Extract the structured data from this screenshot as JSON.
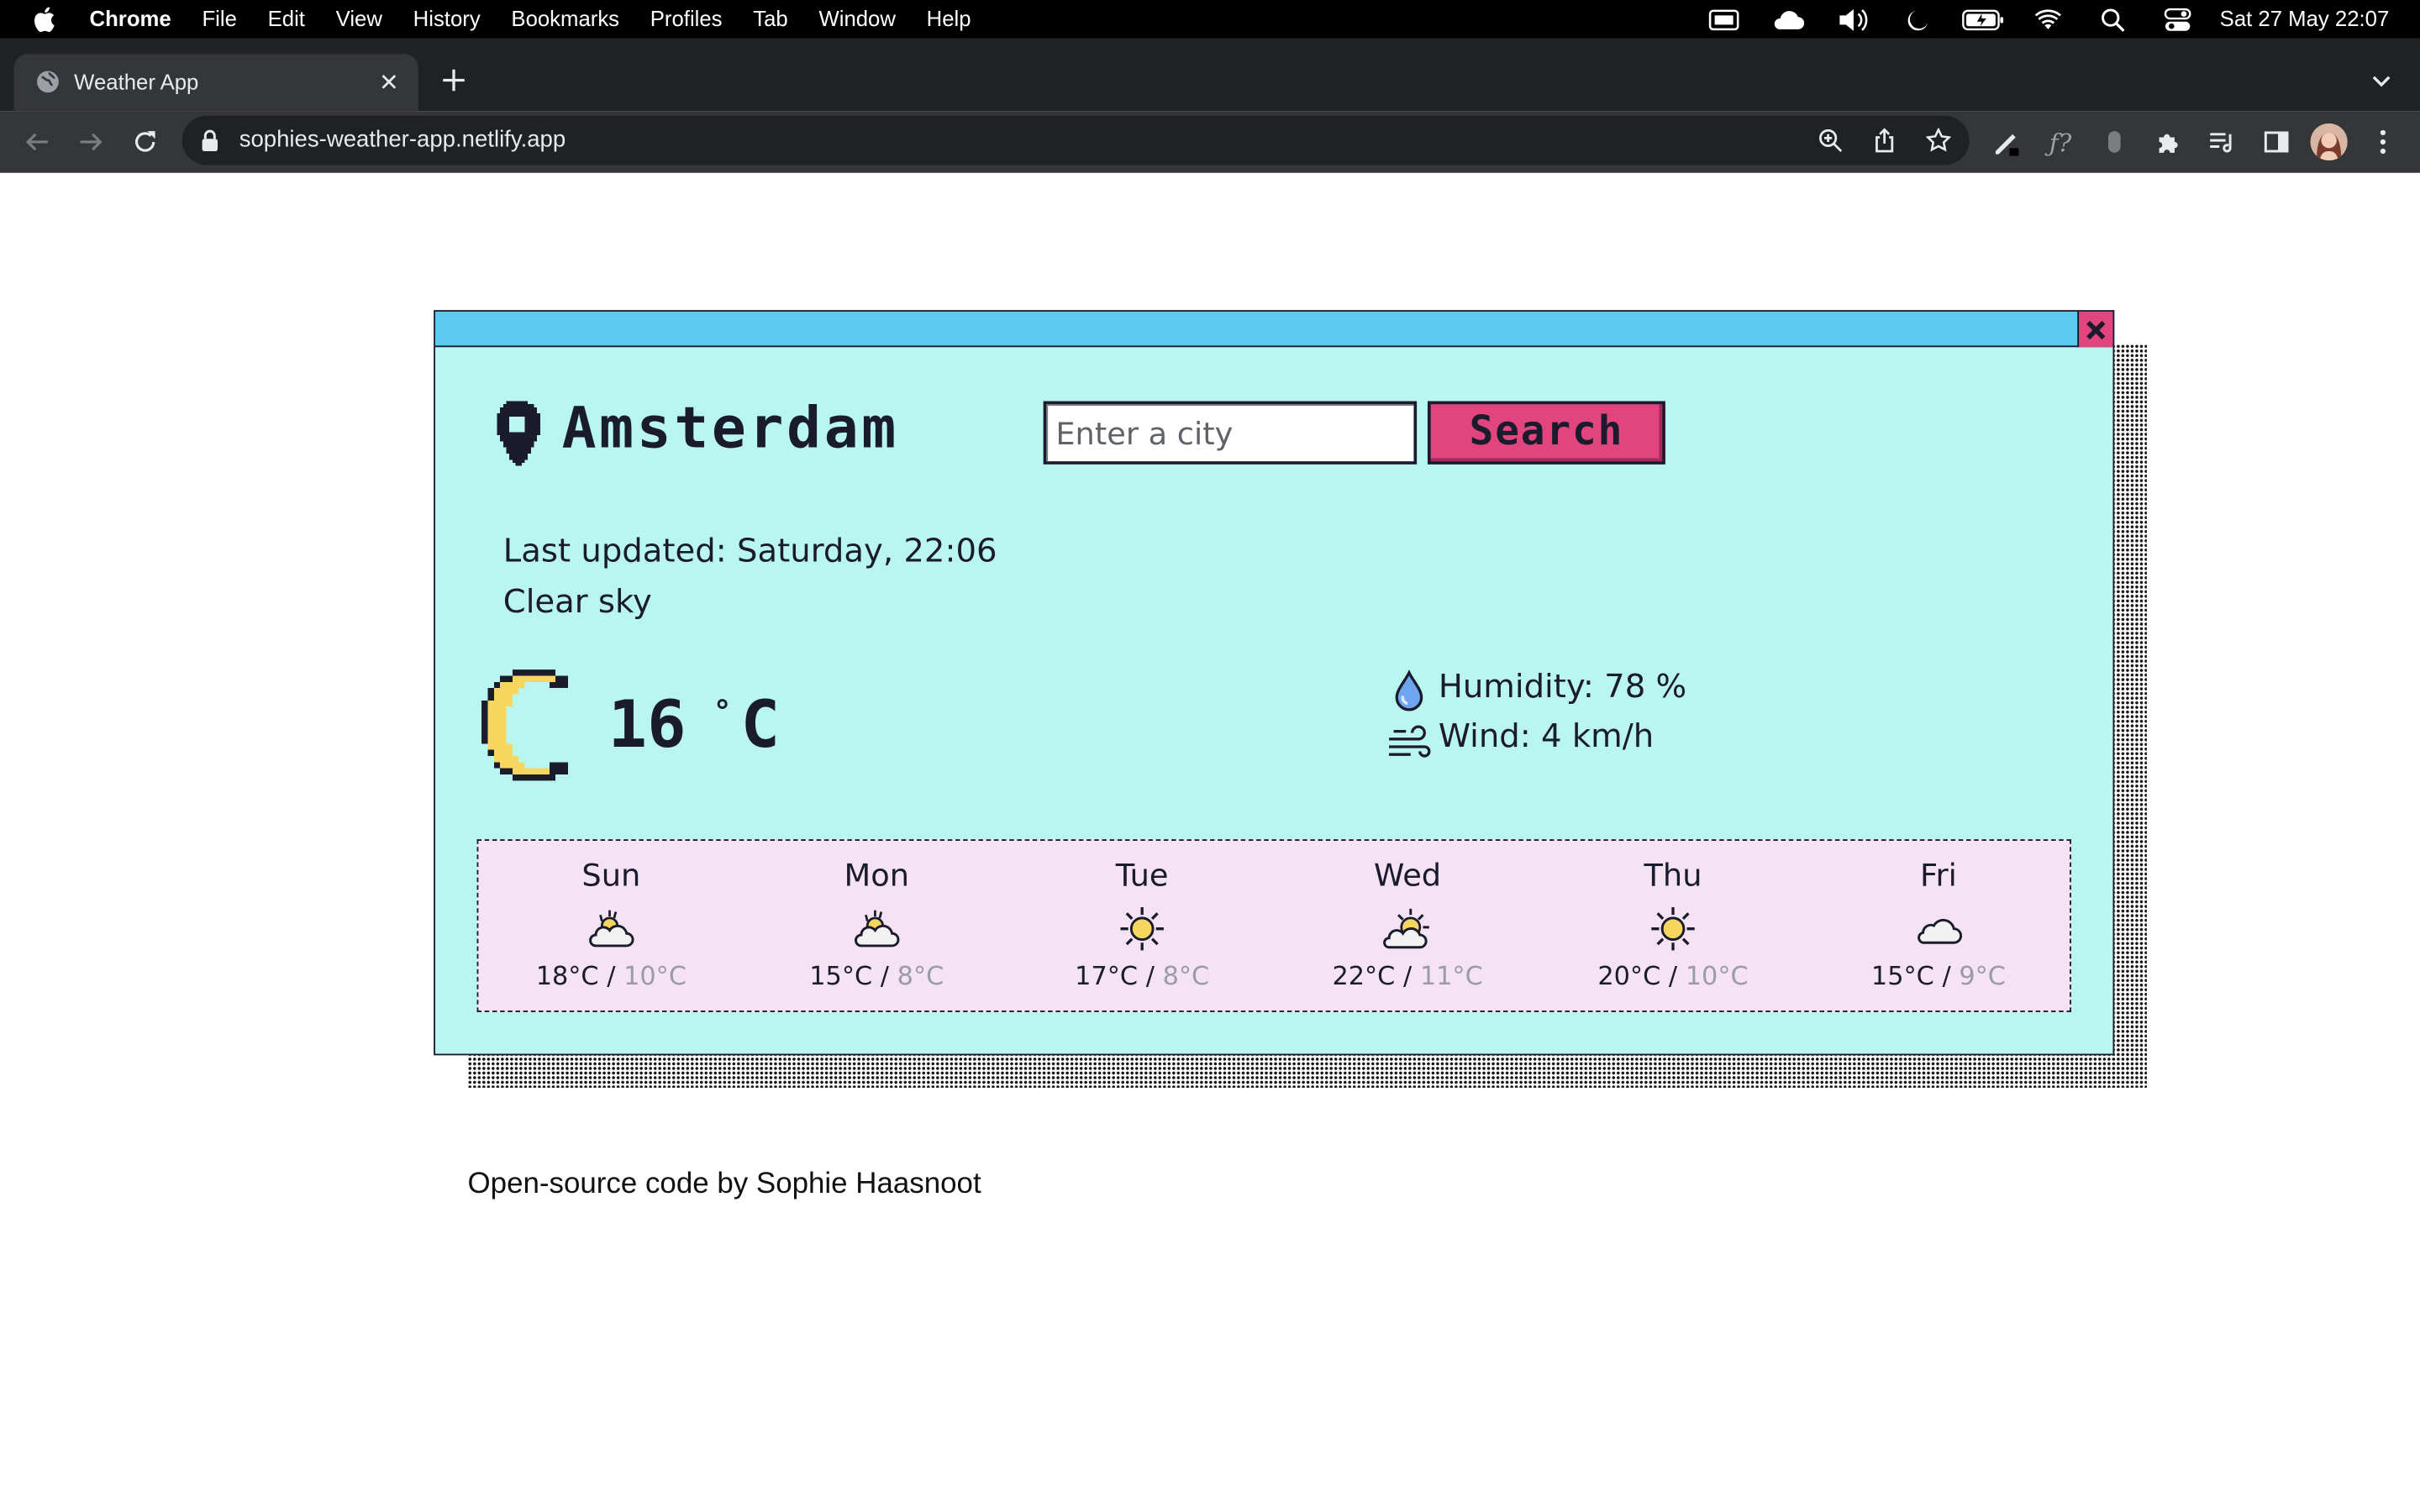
{
  "menubar": {
    "app_name": "Chrome",
    "menus": [
      "File",
      "Edit",
      "View",
      "History",
      "Bookmarks",
      "Profiles",
      "Tab",
      "Window",
      "Help"
    ],
    "clock": "Sat 27 May  22:07"
  },
  "browser": {
    "tab_title": "Weather App",
    "url": "sophies-weather-app.netlify.app"
  },
  "weather": {
    "city": "Amsterdam",
    "search_placeholder": "Enter a city",
    "search_label": "Search",
    "last_updated": "Last updated: Saturday, 22:06",
    "description": "Clear sky",
    "temperature": "16",
    "degree_symbol": "°",
    "unit": "C",
    "humidity": "Humidity: 78 %",
    "wind": "Wind: 4 km/h",
    "forecast": [
      {
        "day": "Sun",
        "high": "18°C",
        "low": "10°C",
        "icon": "cloud-sun-icon"
      },
      {
        "day": "Mon",
        "high": "15°C",
        "low": "8°C",
        "icon": "cloud-sun-icon"
      },
      {
        "day": "Tue",
        "high": "17°C",
        "low": "8°C",
        "icon": "sun-icon"
      },
      {
        "day": "Wed",
        "high": "22°C",
        "low": "11°C",
        "icon": "sun-behind-cloud-icon"
      },
      {
        "day": "Thu",
        "high": "20°C",
        "low": "10°C",
        "icon": "sun-icon"
      },
      {
        "day": "Fri",
        "high": "15°C",
        "low": "9°C",
        "icon": "cloud-icon"
      }
    ]
  },
  "footer": {
    "link_text": "Open-source code",
    "by_text": " by ",
    "author": "Sophie Haasnoot"
  },
  "colors": {
    "window_bg": "#b9f6f0",
    "titlebar": "#5ccaee",
    "accent_pink": "#e2457d",
    "forecast_bg": "#f5e3f3",
    "moon": "#f7d660",
    "low_temp": "#9a9aa8"
  }
}
